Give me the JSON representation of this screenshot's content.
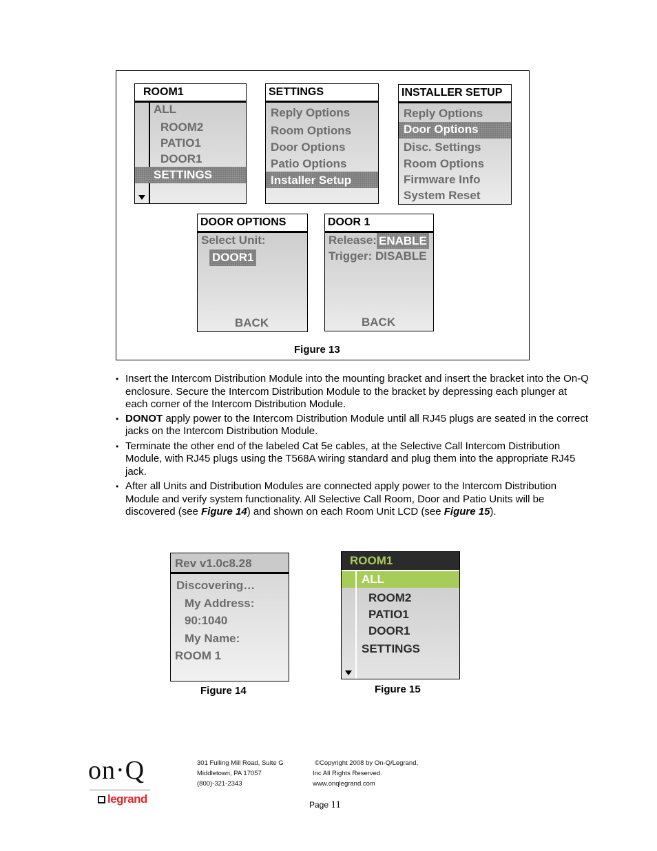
{
  "figure13": {
    "caption": "Figure 13",
    "screen_room1": {
      "title": "ROOM1",
      "items": [
        "ALL",
        "ROOM2",
        "PATIO1",
        "DOOR1",
        "SETTINGS"
      ],
      "selected": "SETTINGS",
      "scroll_icon": "arrow-down-icon"
    },
    "screen_settings": {
      "title": "SETTINGS",
      "items": [
        "Reply Options",
        "Room Options",
        "Door Options",
        "Patio Options",
        "Installer Setup"
      ],
      "selected": "Installer Setup"
    },
    "screen_installer": {
      "title": "INSTALLER SETUP",
      "items": [
        "Reply Options",
        "Door Options",
        "Disc. Settings",
        "Room Options",
        "Firmware Info",
        "System Reset"
      ],
      "selected": "Door Options"
    },
    "screen_door_options": {
      "title": "DOOR OPTIONS",
      "label": "Select Unit:",
      "value": "DOOR1",
      "back": "BACK"
    },
    "screen_door1": {
      "title": "DOOR 1",
      "release_label": "Release:",
      "release_value": "ENABLE",
      "trigger_line": "Trigger: DISABLE",
      "back": "BACK"
    }
  },
  "bullets": [
    {
      "text": "Insert the Intercom Distribution Module into the mounting bracket and insert the bracket into the On-Q enclosure. Secure the Intercom Distribution Module to the bracket by depressing each plunger at each corner of the Intercom Distribution Module."
    },
    {
      "bold": "DONOT",
      "text": " apply power to the Intercom Distribution Module until all RJ45 plugs are seated in the correct jacks on the Intercom Distribution Module."
    },
    {
      "text": "Terminate the other end of the labeled Cat 5e cables, at the Selective Call Intercom Distribution Module, with RJ45 plugs using the T568A wiring standard and plug them into the appropriate RJ45 jack."
    },
    {
      "part1": "After all Units and Distribution Modules are connected apply power to the Intercom Distribution Module and verify system functionality. All Selective Call Room, Door and Patio Units will be discovered (see ",
      "ref1": "Figure 14",
      "part2": ") and shown on each Room Unit LCD (see ",
      "ref2": "Figure 15",
      "part3": ")."
    }
  ],
  "figure14": {
    "caption": "Figure 14",
    "title": "Rev  v1.0c8.28",
    "lines": [
      "Discovering…",
      "My Address:",
      "90:1040",
      "My Name:",
      "ROOM 1"
    ]
  },
  "figure15": {
    "caption": "Figure 15",
    "title": "ROOM1",
    "items": [
      "ALL",
      "ROOM2",
      "PATIO1",
      "DOOR1",
      "SETTINGS"
    ],
    "selected": "ALL",
    "accent_color": "#a8cc5a",
    "header_color": "#2b2b2b"
  },
  "footer": {
    "logo_text": "on·Q",
    "brand_text": "legrand",
    "address": [
      "301 Fulling Mill Road, Suite G",
      "Middletown, PA   17057",
      "(800)-321-2343"
    ],
    "copyright": [
      "©Copyright 2008 by On-Q/Legrand,",
      "Inc All Rights Reserved.",
      "www.onqlegrand.com"
    ],
    "page_label": "Page",
    "page_number": "11"
  }
}
